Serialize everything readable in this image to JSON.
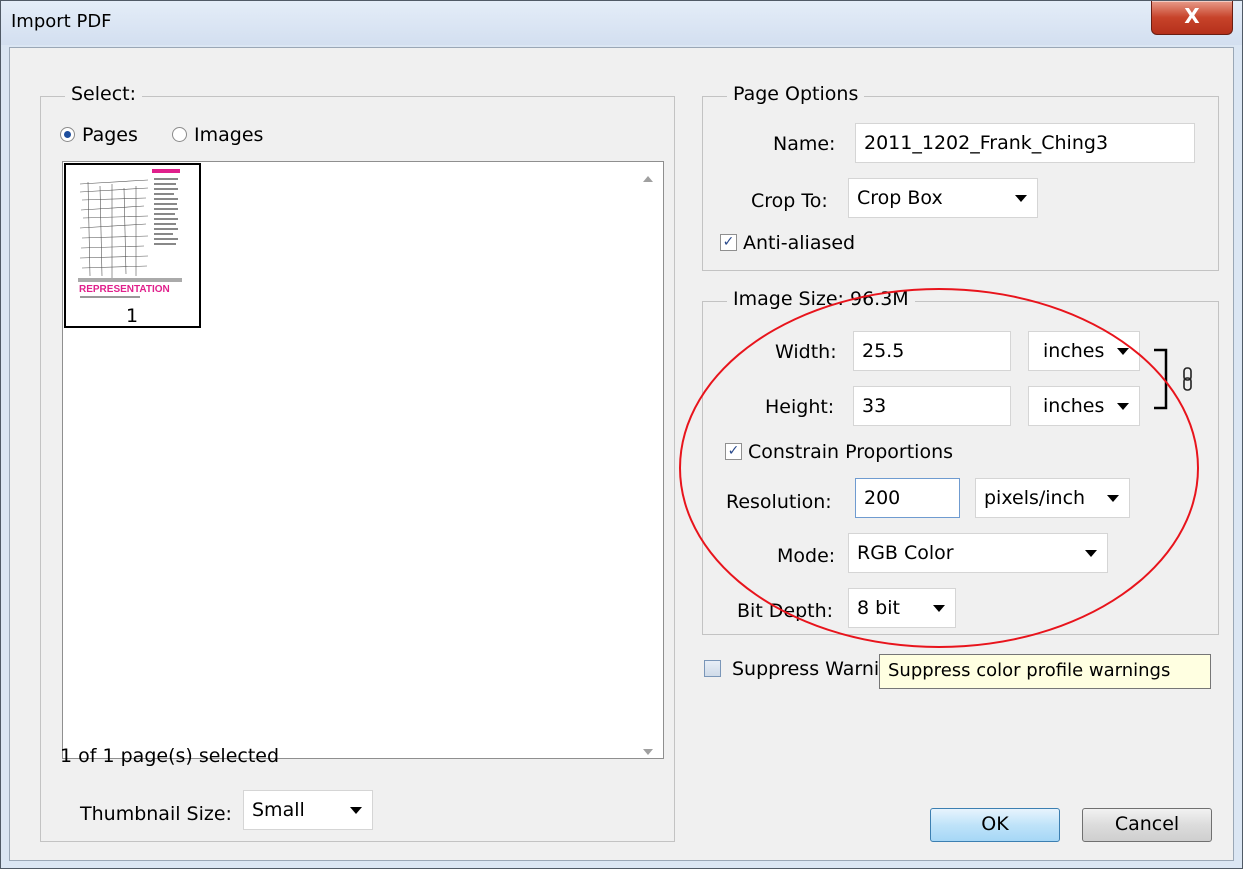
{
  "window": {
    "title": "Import PDF",
    "close_glyph": "X"
  },
  "select_group": {
    "legend": "Select:",
    "radio_pages": "Pages",
    "radio_images": "Images",
    "selected_radio": "Pages",
    "thumbnails": [
      {
        "page_number": "1",
        "label_text": "REPRESENTATION"
      }
    ],
    "status": "1 of 1 page(s) selected",
    "thumbnail_size_label": "Thumbnail Size:",
    "thumbnail_size_value": "Small"
  },
  "page_options": {
    "legend": "Page Options",
    "name_label": "Name:",
    "name_value": "2011_1202_Frank_Ching3",
    "crop_label": "Crop To:",
    "crop_value": "Crop Box",
    "anti_aliased_label": "Anti-aliased",
    "anti_aliased_checked": true
  },
  "image_size": {
    "legend": "Image Size: 96.3M",
    "width_label": "Width:",
    "width_value": "25.5",
    "width_unit": "inches",
    "height_label": "Height:",
    "height_value": "33",
    "height_unit": "inches",
    "constrain_label": "Constrain Proportions",
    "constrain_checked": true,
    "resolution_label": "Resolution:",
    "resolution_value": "200",
    "resolution_unit": "pixels/inch",
    "mode_label": "Mode:",
    "mode_value": "RGB Color",
    "bit_depth_label": "Bit Depth:",
    "bit_depth_value": "8 bit",
    "link_icon": "chain-link-icon"
  },
  "suppress_warnings": {
    "label": "Suppress Warnings",
    "checked": false
  },
  "tooltip": "Suppress color profile warnings",
  "buttons": {
    "ok": "OK",
    "cancel": "Cancel"
  },
  "colors": {
    "annotation": "#e8141c",
    "accent_pink": "#e0208c",
    "ok_border": "#3c7fb1"
  }
}
